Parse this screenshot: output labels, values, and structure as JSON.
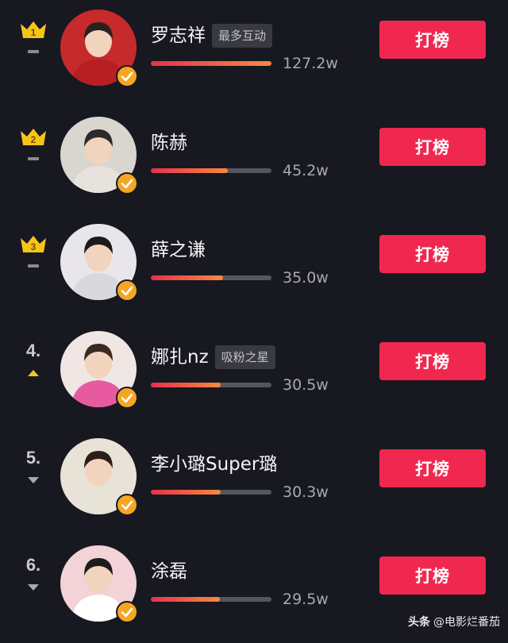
{
  "leaderboard": {
    "button_label": "打榜",
    "accent_color": "#f02850",
    "entries": [
      {
        "rank": "1",
        "rank_style": "crown",
        "crown_color": "#f5c518",
        "trend": "flat",
        "name": "罗志祥",
        "tag": "最多互动",
        "score": "127.2w",
        "progress": 1.0,
        "verified": true
      },
      {
        "rank": "2",
        "rank_style": "crown",
        "crown_color": "#f5c518",
        "trend": "flat",
        "name": "陈赫",
        "tag": "",
        "score": "45.2w",
        "progress": 0.64,
        "verified": true
      },
      {
        "rank": "3",
        "rank_style": "crown",
        "crown_color": "#f5c518",
        "trend": "flat",
        "name": "薛之谦",
        "tag": "",
        "score": "35.0w",
        "progress": 0.6,
        "verified": true
      },
      {
        "rank": "4.",
        "rank_style": "number",
        "trend": "up",
        "name": "娜扎nz",
        "tag": "吸粉之星",
        "score": "30.5w",
        "progress": 0.58,
        "verified": true
      },
      {
        "rank": "5.",
        "rank_style": "number",
        "trend": "down",
        "name": "李小璐Super璐",
        "tag": "",
        "score": "30.3w",
        "progress": 0.58,
        "verified": true
      },
      {
        "rank": "6.",
        "rank_style": "number",
        "trend": "down",
        "name": "涂磊",
        "tag": "",
        "score": "29.5w",
        "progress": 0.57,
        "verified": true
      }
    ]
  },
  "footer": {
    "brand": "头条",
    "handle": "@电影烂番茄"
  }
}
